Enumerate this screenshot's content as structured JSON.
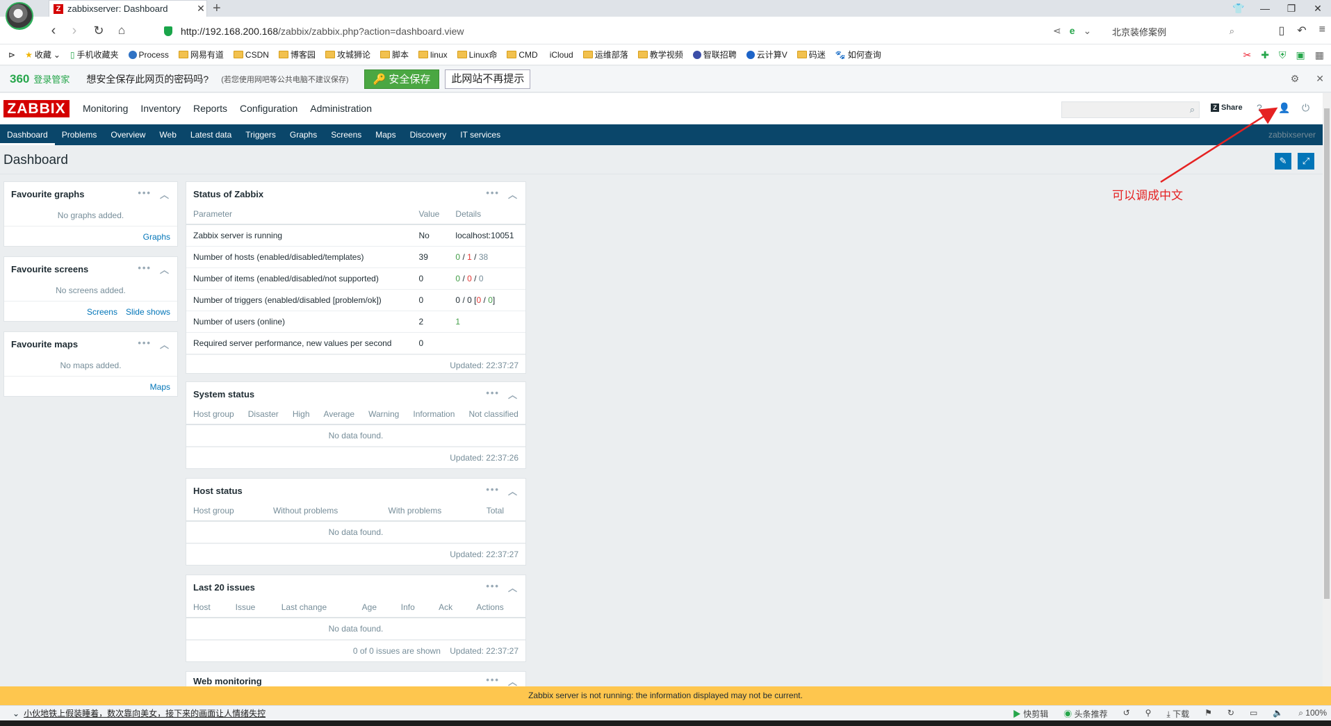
{
  "browser": {
    "tab_title": "zabbixserver: Dashboard",
    "tab_favicon": "Z",
    "new_tab": "+",
    "url_host": "http://192.168.200.168",
    "url_path": "/zabbix/zabbix.php?action=dashboard.view",
    "search_text": "北京装修案例",
    "bookmarks": [
      {
        "label": "收藏",
        "icon": "star-icon"
      },
      {
        "label": "手机收藏夹",
        "icon": "phone-icon"
      },
      {
        "label": "Process",
        "icon": "globe-icon"
      },
      {
        "label": "网易有道",
        "icon": "folder-icon"
      },
      {
        "label": "CSDN",
        "icon": "folder-icon"
      },
      {
        "label": "博客园",
        "icon": "folder-icon"
      },
      {
        "label": "攻城狮论",
        "icon": "folder-icon"
      },
      {
        "label": "脚本",
        "icon": "folder-icon"
      },
      {
        "label": "linux",
        "icon": "folder-icon"
      },
      {
        "label": "Linux命",
        "icon": "folder-icon"
      },
      {
        "label": "CMD",
        "icon": "folder-icon"
      },
      {
        "label": "iCloud",
        "icon": "apple-icon"
      },
      {
        "label": "运维部落",
        "icon": "folder-icon"
      },
      {
        "label": "教学视频",
        "icon": "folder-icon"
      },
      {
        "label": "智联招聘",
        "icon": "zhaopin-icon"
      },
      {
        "label": "云计算V",
        "icon": "cloud-icon"
      },
      {
        "label": "码迷",
        "icon": "folder-icon"
      },
      {
        "label": "如何查询",
        "icon": "paw-icon"
      }
    ],
    "password_bar": {
      "logo": "360",
      "logo_sub": "登录管家",
      "question": "想安全保存此网页的密码吗?",
      "note": "(若您使用网吧等公共电脑不建议保存)",
      "save_label": "安全保存",
      "never_label": "此网站不再提示"
    },
    "status_news": "小伙地铁上假装睡着，数次靠向美女，接下来的画面让人情绪失控",
    "status_items": [
      "快剪辑",
      "头条推荐",
      "下载",
      "100%"
    ]
  },
  "zabbix": {
    "logo": "ZABBIX",
    "top_menu": [
      "Monitoring",
      "Inventory",
      "Reports",
      "Configuration",
      "Administration"
    ],
    "share_label": "Share",
    "help_label": "?",
    "sub_menu": [
      "Dashboard",
      "Problems",
      "Overview",
      "Web",
      "Latest data",
      "Triggers",
      "Graphs",
      "Screens",
      "Maps",
      "Discovery",
      "IT services"
    ],
    "server_name": "zabbixserver",
    "page_title": "Dashboard",
    "fav_graphs": {
      "title": "Favourite graphs",
      "empty": "No graphs added.",
      "links": [
        "Graphs"
      ]
    },
    "fav_screens": {
      "title": "Favourite screens",
      "empty": "No screens added.",
      "links": [
        "Screens",
        "Slide shows"
      ]
    },
    "fav_maps": {
      "title": "Favourite maps",
      "empty": "No maps added.",
      "links": [
        "Maps"
      ]
    },
    "status": {
      "title": "Status of Zabbix",
      "headers": [
        "Parameter",
        "Value",
        "Details"
      ],
      "rows": [
        {
          "param": "Zabbix server is running",
          "value": "No",
          "details": "localhost:10051"
        },
        {
          "param": "Number of hosts (enabled/disabled/templates)",
          "value": "39",
          "d1": "0",
          "d2": "1",
          "d3": "38"
        },
        {
          "param": "Number of items (enabled/disabled/not supported)",
          "value": "0",
          "d1": "0",
          "d2": "0",
          "d3": "0"
        },
        {
          "param": "Number of triggers (enabled/disabled [problem/ok])",
          "value": "0",
          "d1": "0",
          "d2": "0",
          "d3": "0",
          "d4": "0"
        },
        {
          "param": "Number of users (online)",
          "value": "2",
          "d1": "1"
        },
        {
          "param": "Required server performance, new values per second",
          "value": "0"
        }
      ],
      "updated": "Updated: 22:37:27"
    },
    "system_status": {
      "title": "System status",
      "headers": [
        "Host group",
        "Disaster",
        "High",
        "Average",
        "Warning",
        "Information",
        "Not classified"
      ],
      "empty": "No data found.",
      "updated": "Updated: 22:37:26"
    },
    "host_status": {
      "title": "Host status",
      "headers": [
        "Host group",
        "Without problems",
        "With problems",
        "Total"
      ],
      "empty": "No data found.",
      "updated": "Updated: 22:37:27"
    },
    "last_issues": {
      "title": "Last 20 issues",
      "headers": [
        "Host",
        "Issue",
        "Last change",
        "Age",
        "Info",
        "Ack",
        "Actions"
      ],
      "empty": "No data found.",
      "shown": "0 of 0 issues are shown",
      "updated": "Updated: 22:37:27"
    },
    "web_monitoring": {
      "title": "Web monitoring"
    },
    "warning": "Zabbix server is not running: the information displayed may not be current."
  },
  "annotation": {
    "text": "可以调成中文",
    "color": "#e52222"
  },
  "colors": {
    "zabbix_red": "#d40000",
    "nav_blue": "#0a466a",
    "warning_yellow": "#fec64e",
    "save_green": "#4aa742"
  }
}
